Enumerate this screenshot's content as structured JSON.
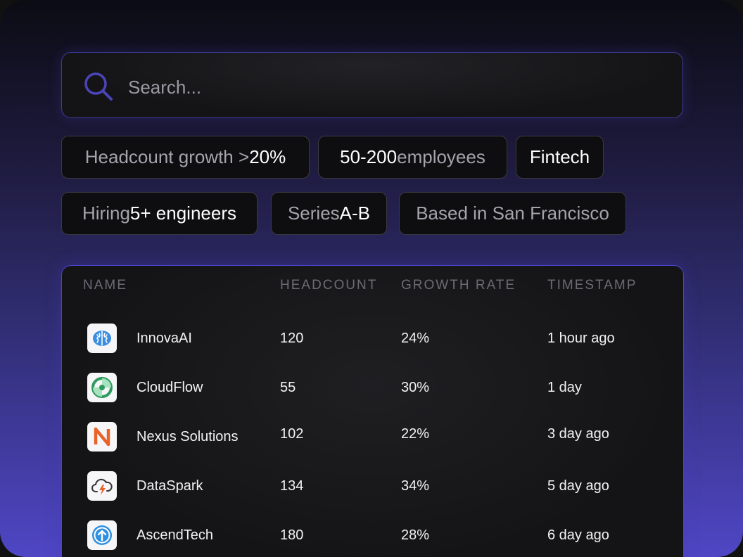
{
  "search": {
    "placeholder": "Search..."
  },
  "filters": [
    {
      "dim_before": "Headcount growth > ",
      "bright": "20%",
      "dim_after": ""
    },
    {
      "dim_before": "",
      "bright": "50-200",
      "dim_after": " employees"
    },
    {
      "dim_before": "",
      "bright": "Fintech",
      "dim_after": ""
    },
    {
      "dim_before": "Hiring ",
      "bright": "5+ engineers",
      "dim_after": ""
    },
    {
      "dim_before": "Series ",
      "bright": "A-B",
      "dim_after": ""
    },
    {
      "dim_before": "Based in San Francisco",
      "bright": "",
      "dim_after": ""
    }
  ],
  "table": {
    "columns": [
      "NAME",
      "HEADCOUNT",
      "GROWTH RATE",
      "TIMESTAMP"
    ],
    "rows": [
      {
        "name": "InnovaAI",
        "headcount": "120",
        "growth": "24%",
        "timestamp": "1 hour ago",
        "icon": "brain-icon",
        "icon_color": "#3b8de0"
      },
      {
        "name": "CloudFlow",
        "headcount": "55",
        "growth": "30%",
        "timestamp": "1 day",
        "icon": "swirl-icon",
        "icon_color": "#2e9a5e"
      },
      {
        "name": "Nexus Solutions",
        "headcount": "102",
        "growth": "22%",
        "timestamp": "3 day ago",
        "icon": "n-letter-icon",
        "icon_color": "#e8632a"
      },
      {
        "name": "DataSpark",
        "headcount": "134",
        "growth": "34%",
        "timestamp": "5 day ago",
        "icon": "cloud-lightning-icon",
        "icon_color": "#e8632a"
      },
      {
        "name": "AscendTech",
        "headcount": "180",
        "growth": "28%",
        "timestamp": "6 day ago",
        "icon": "arrow-up-circle-icon",
        "icon_color": "#2f8fe0"
      }
    ]
  },
  "colors": {
    "accent": "#4a44c8",
    "background_bottom": "#4f46c4",
    "panel": "#141416"
  }
}
